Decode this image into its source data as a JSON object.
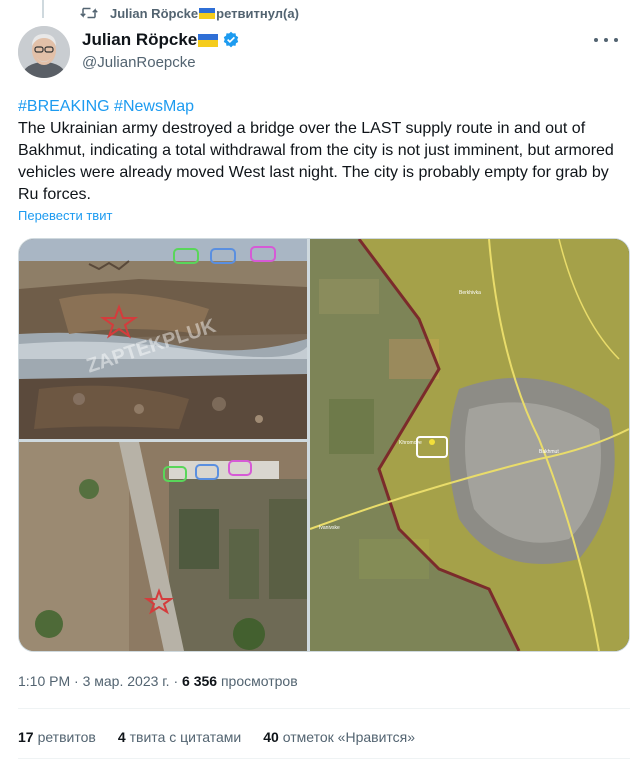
{
  "retweet": {
    "user": "Julian Röpcke",
    "suffix": "ретвитнул(а)"
  },
  "author": {
    "name": "Julian Röpcke",
    "handle": "@JulianRoepcke"
  },
  "tweet": {
    "hashtag1": "#BREAKING",
    "hashtag2": "#NewsMap",
    "text": "The Ukrainian army destroyed a bridge over the LAST supply route in and out of Bakhmut, indicating a total withdrawal from the city is not just imminent, but armored vehicles were already moved West last night. The city is probably empty for grab by Ru forces.",
    "translate": "Перевести твит"
  },
  "media": {
    "watermark": "ZAPTEKPLUK"
  },
  "meta": {
    "time": "1:10 PM",
    "separator": " · ",
    "date": "3 мар. 2023 г.",
    "views_count": "6 356",
    "views_label": "просмотров"
  },
  "stats": {
    "retweets_count": "17",
    "retweets_label": "ретвитов",
    "quotes_count": "4",
    "quotes_label": "твита с цитатами",
    "likes_count": "40",
    "likes_label": "отметок «Нравится»"
  },
  "colors": {
    "link": "#1d9bf0",
    "secondary": "#536471",
    "verified": "#1d9bf0"
  }
}
